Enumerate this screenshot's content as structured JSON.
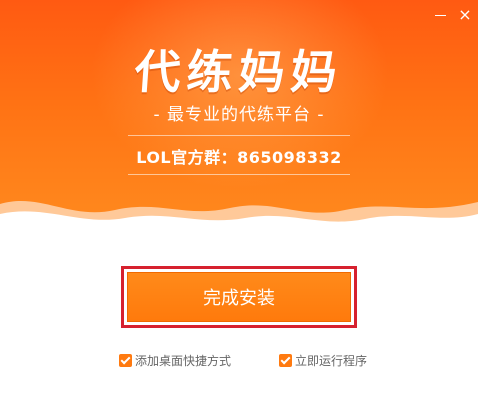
{
  "window": {
    "minimize_icon": "minimize-icon",
    "close_icon": "close-icon",
    "close_glyph": "×"
  },
  "banner": {
    "logo_text": "代练妈妈",
    "slogan": "- 最专业的代练平台 -",
    "group_text": "LOL官方群：865098332",
    "colors": {
      "top": "#ff5a12",
      "bottom": "#ff8a1e"
    }
  },
  "actions": {
    "finish_label": "完成安装",
    "accent": "#ff7a0c",
    "focus_color": "#d6212f"
  },
  "options": [
    {
      "label": "添加桌面快捷方式",
      "checked": true
    },
    {
      "label": "立即运行程序",
      "checked": true
    }
  ]
}
